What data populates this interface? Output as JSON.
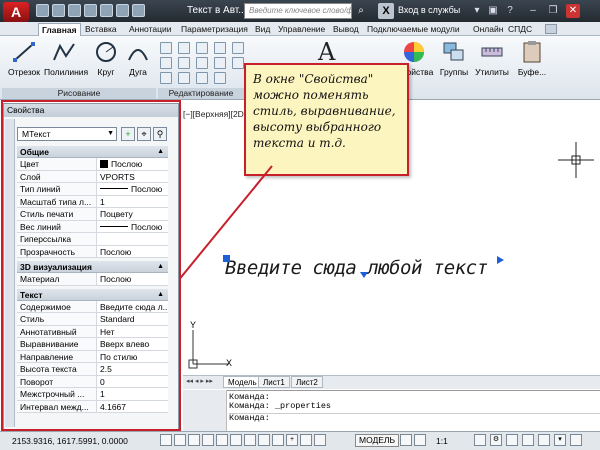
{
  "app": {
    "logo": "A",
    "title": "Текст в Авт...",
    "search_placeholder": "Введите ключевое слово/фразу",
    "login": "Вход в службы"
  },
  "tabs": [
    "Главная",
    "Вставка",
    "Аннотации",
    "Параметризация",
    "Вид",
    "Управление",
    "Вывод",
    "Подключаемые модули",
    "Онлайн",
    "СПДС"
  ],
  "ribbon": {
    "buttons": [
      "Отрезок",
      "Полилиния",
      "Круг",
      "Дуга"
    ],
    "panels": [
      "Рисование",
      "Редактирование"
    ],
    "right": [
      "Свойства",
      "Группы",
      "Утилиты",
      "Буфе..."
    ],
    "text_btn": "A"
  },
  "drawing": {
    "header": "[−][Верхняя][2D",
    "sample_text": "Введите сюда любой текст",
    "ucs_y": "Y",
    "ucs_x": "X"
  },
  "callout": "В окне \"Свойства\" можно поменять стиль, выравнивание, высоту выбранного текста и т.д.",
  "palette": {
    "title": "Свойства",
    "object_type": "МТекст",
    "sections": [
      {
        "name": "Общие",
        "rows": [
          {
            "k": "Цвет",
            "v": "Послою",
            "swatch": true
          },
          {
            "k": "Слой",
            "v": "VPORTS"
          },
          {
            "k": "Тип линий",
            "v": "Послою",
            "line": true
          },
          {
            "k": "Масштаб типа л...",
            "v": "1"
          },
          {
            "k": "Стиль печати",
            "v": "Поцвету"
          },
          {
            "k": "Вес линий",
            "v": "Послою",
            "line": true
          },
          {
            "k": "Гиперссылка",
            "v": ""
          },
          {
            "k": "Прозрачность",
            "v": "Послою"
          }
        ]
      },
      {
        "name": "3D визуализация",
        "rows": [
          {
            "k": "Материал",
            "v": "Послою"
          }
        ]
      },
      {
        "name": "Текст",
        "rows": [
          {
            "k": "Содержимое",
            "v": "Введите сюда л..."
          },
          {
            "k": "Стиль",
            "v": "Standard"
          },
          {
            "k": "Аннотативный",
            "v": "Нет"
          },
          {
            "k": "Выравнивание",
            "v": "Вверх влево"
          },
          {
            "k": "Направление",
            "v": "По стилю"
          },
          {
            "k": "Высота текста",
            "v": "2.5"
          },
          {
            "k": "Поворот",
            "v": "0"
          },
          {
            "k": "Межстрочный ...",
            "v": "1"
          },
          {
            "k": "Интервал межд...",
            "v": "4.1667"
          }
        ]
      }
    ]
  },
  "layout_tabs": [
    "Модель",
    "Лист1",
    "Лист2"
  ],
  "command": {
    "lines": [
      "Команда:",
      "Команда:  _properties"
    ],
    "prompt": "Команда:"
  },
  "status": {
    "coords": "2153.9316, 1617.5991, 0.0000",
    "model": "МОДЕЛЬ",
    "scale": "1:1"
  }
}
